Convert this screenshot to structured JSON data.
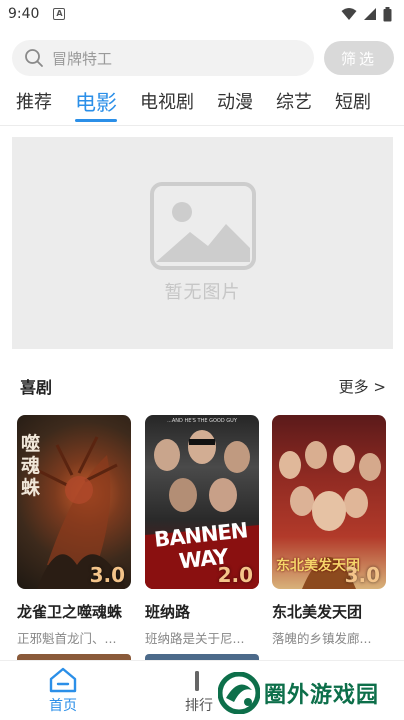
{
  "status_bar": {
    "time": "9:40",
    "a_badge": "A"
  },
  "search": {
    "placeholder": "冒牌特工",
    "filter_label": "筛选"
  },
  "tabs": [
    {
      "label": "推荐",
      "active": false
    },
    {
      "label": "电影",
      "active": true
    },
    {
      "label": "电视剧",
      "active": false
    },
    {
      "label": "动漫",
      "active": false
    },
    {
      "label": "综艺",
      "active": false
    },
    {
      "label": "短剧",
      "active": false
    }
  ],
  "banner": {
    "placeholder_text": "暂无图片"
  },
  "section": {
    "title": "喜剧",
    "more_label": "更多 >",
    "items": [
      {
        "title": "龙雀卫之噬魂蛛",
        "desc": "正邪魁首龙门、...",
        "rating": "3.0",
        "poster_text": "噬魂蛛"
      },
      {
        "title": "班纳路",
        "desc": "班纳路是关于尼...",
        "rating": "2.0",
        "poster_text": "BANNEN WAY",
        "poster_tagline": "...AND HE'S THE GOOD GUY"
      },
      {
        "title": "东北美发天团",
        "desc": "落魄的乡镇发廊...",
        "rating": "3.0",
        "poster_text": "东北美发天团"
      }
    ]
  },
  "bottom_nav": {
    "items": [
      {
        "label": "首页",
        "active": true
      },
      {
        "label": "排行",
        "active": false
      }
    ]
  },
  "watermark": {
    "text": "圈外游戏园"
  },
  "colors": {
    "accent": "#2b8fe8",
    "rating": "#f4c48a",
    "watermark": "#0d6f4a"
  }
}
